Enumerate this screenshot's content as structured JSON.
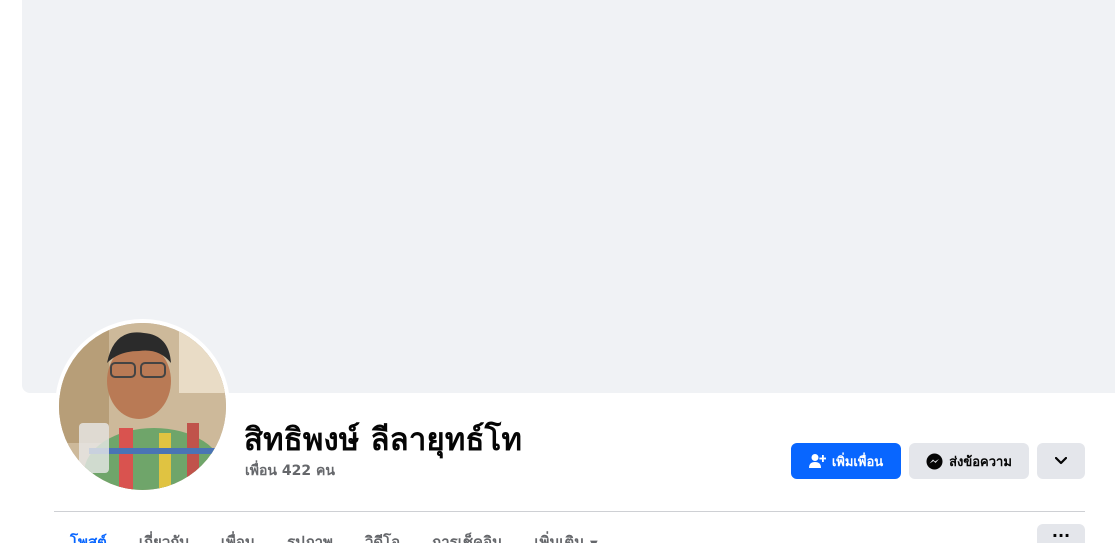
{
  "profile": {
    "name": "สิทธิพงษ์ ลีลายุทธ์โท",
    "friends_count": "เพื่อน 422 คน"
  },
  "actions": {
    "add_friend": "เพิ่มเพื่อน",
    "message": "ส่งข้อความ"
  },
  "tabs": [
    {
      "label": "โพสต์",
      "active": true
    },
    {
      "label": "เกี่ยวกับ"
    },
    {
      "label": "เพื่อน"
    },
    {
      "label": "รูปภาพ"
    },
    {
      "label": "วิดีโอ"
    },
    {
      "label": "การเช็คอิน"
    },
    {
      "label": "เพิ่มเติม"
    }
  ],
  "icons": {
    "add_friend": "add-person-icon",
    "message": "messenger-icon",
    "more": "chevron-down-icon",
    "tab_more": "ellipsis-icon"
  },
  "colors": {
    "accent": "#0866ff",
    "cover": "#f0f2f5",
    "button_gray": "#e4e6eb"
  }
}
